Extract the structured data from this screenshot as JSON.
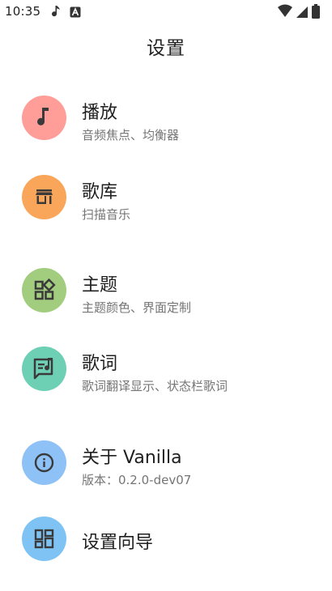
{
  "status_bar": {
    "time": "10:35",
    "notification_icons": [
      "music-note-icon",
      "font-app-icon"
    ],
    "system_icons": [
      "wifi-icon",
      "cellular-signal-icon",
      "battery-icon"
    ]
  },
  "header": {
    "title": "设置"
  },
  "settings": {
    "items": [
      {
        "title": "播放",
        "subtitle": "音频焦点、均衡器",
        "icon": "music-note-icon",
        "color": "#FF9E98"
      },
      {
        "title": "歌库",
        "subtitle": "扫描音乐",
        "icon": "storefront-icon",
        "color": "#F9A65A"
      },
      {
        "title": "主题",
        "subtitle": "主题颜色、界面定制",
        "icon": "widgets-icon",
        "color": "#A2CC7E"
      },
      {
        "title": "歌词",
        "subtitle": "歌词翻译显示、状态栏歌词",
        "icon": "lyrics-icon",
        "color": "#6DD0B5"
      },
      {
        "title": "关于 Vanilla",
        "subtitle": "版本：0.2.0-dev07",
        "icon": "info-icon",
        "color": "#8EC1F6"
      },
      {
        "title": "设置向导",
        "subtitle": "",
        "icon": "dashboard-icon",
        "color": "#7EC3F4"
      }
    ]
  }
}
